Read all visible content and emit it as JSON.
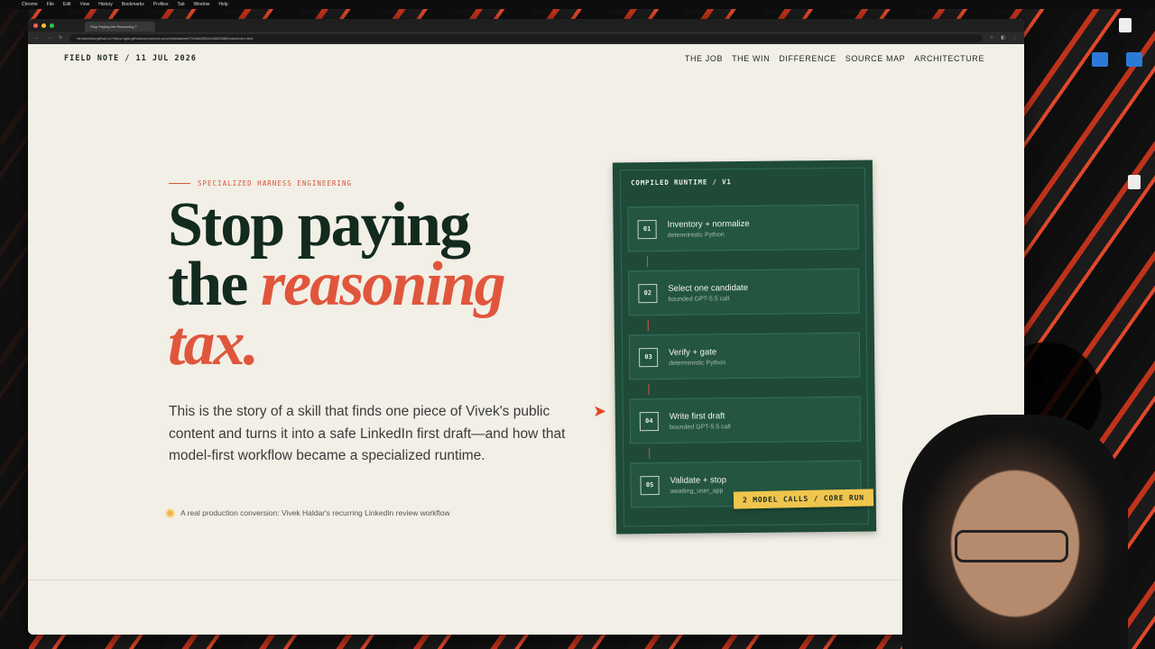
{
  "browser": {
    "tab_title": "Stop Paying the Reasoning T",
    "address": "htmlpreview.github.io/?https://gist.githubusercontent.com/vivekhaldar/f7924d62f0942c5d530f62/raw/index.html"
  },
  "header": {
    "field_note": "FIELD NOTE / 11 JUL 2026",
    "nav": [
      "THE JOB",
      "THE WIN",
      "DIFFERENCE",
      "SOURCE MAP",
      "ARCHITECTURE"
    ]
  },
  "hero": {
    "eyebrow": "SPECIALIZED HARNESS ENGINEERING",
    "headline_line1": "Stop paying",
    "headline_line2_plain": "the ",
    "headline_line2_accent": "reasoning",
    "headline_line3_accent": "tax.",
    "lead": "This is the story of a skill that finds one piece of Vivek's public content and turns it into a safe LinkedIn first draft—and how that model-first workflow became a specialized runtime.",
    "note": "A real production conversion: Vivek Haldar's recurring LinkedIn review workflow"
  },
  "runtime_card": {
    "title": "COMPILED RUNTIME / V1",
    "steps": [
      {
        "num": "01",
        "title": "Inventory + normalize",
        "sub": "deterministic Python"
      },
      {
        "num": "02",
        "title": "Select one candidate",
        "sub": "bounded GPT-5.5 call"
      },
      {
        "num": "03",
        "title": "Verify + gate",
        "sub": "deterministic Python"
      },
      {
        "num": "04",
        "title": "Write first draft",
        "sub": "bounded GPT-5.5 call"
      },
      {
        "num": "05",
        "title": "Validate + stop",
        "sub": "awaiting_user_app"
      }
    ],
    "badge": "2 MODEL CALLS / CORE RUN"
  },
  "colors": {
    "accent": "#e0563c",
    "card": "#1f4a38",
    "badge": "#f0c54d",
    "page_bg": "#f2efe6"
  }
}
